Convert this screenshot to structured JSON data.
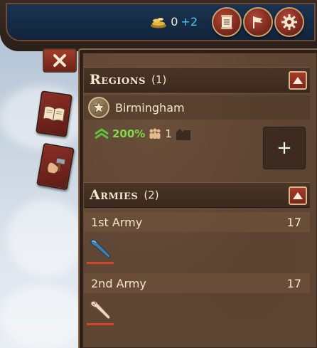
{
  "resources": {
    "gold_value": "0",
    "gold_delta": "+2",
    "gold_icon": "coin-pile-icon"
  },
  "top_buttons": [
    {
      "name": "scroll-button",
      "icon": "scroll-icon"
    },
    {
      "name": "flag-button",
      "icon": "flag-icon"
    },
    {
      "name": "settings-button",
      "icon": "gear-icon"
    }
  ],
  "side_cards": [
    {
      "name": "book-card",
      "icon": "open-book-icon"
    },
    {
      "name": "build-card",
      "icon": "hammer-fist-icon"
    }
  ],
  "regions": {
    "title": "Regions",
    "count": "(1)",
    "items": [
      {
        "name": "Birmingham",
        "growth": "200%",
        "population": "1"
      }
    ],
    "add_label": "+"
  },
  "armies": {
    "title": "Armies",
    "count": "(2)",
    "items": [
      {
        "name": "1st Army",
        "count": "17",
        "icon": "club-icon",
        "icon_color": "#3f7fa8"
      },
      {
        "name": "2nd Army",
        "count": "17",
        "icon": "bone-club-icon",
        "icon_color": "#f1d6c3"
      }
    ]
  },
  "colors": {
    "accent_red": "#a53c2a",
    "growth_green": "#7fd94a",
    "income_blue": "#4fc4f0",
    "health_bar": "#d8432b"
  }
}
